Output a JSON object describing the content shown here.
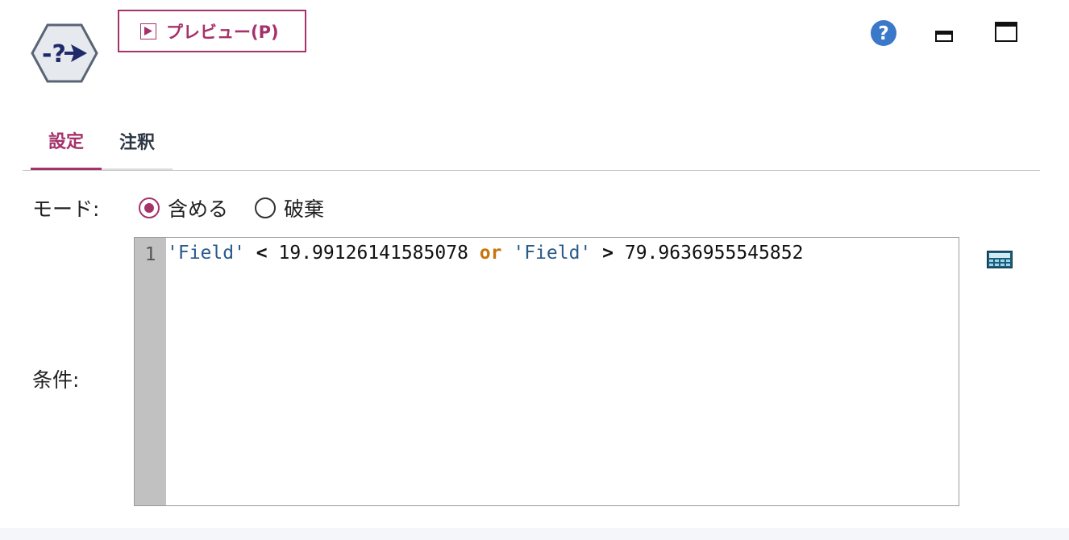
{
  "node_icon": "select-node-icon",
  "toolbar": {
    "preview_label": "プレビュー(P)",
    "preview_icon": "play-icon",
    "help_icon": "help-icon",
    "minimize_icon": "minimize-icon",
    "maximize_icon": "maximize-icon"
  },
  "tabs": [
    {
      "label": "設定",
      "selected": true
    },
    {
      "label": "注釈",
      "selected": false
    }
  ],
  "mode": {
    "label": "モード:",
    "options": [
      {
        "label": "含める",
        "selected": true
      },
      {
        "label": "破棄",
        "selected": false
      }
    ]
  },
  "condition": {
    "label": "条件:",
    "line_number": "1",
    "tokens": {
      "field1": "'Field'",
      "op1": "<",
      "value1": "19.99126141585078",
      "keyword": "or",
      "field2": "'Field'",
      "op2": ">",
      "value2": "79.9636955545852"
    },
    "calculator_icon": "expression-builder-icon"
  },
  "colors": {
    "accent": "#a5326b",
    "string_token": "#2a5a8a",
    "keyword_token": "#c8750c",
    "help_blue": "#3a78c9"
  }
}
